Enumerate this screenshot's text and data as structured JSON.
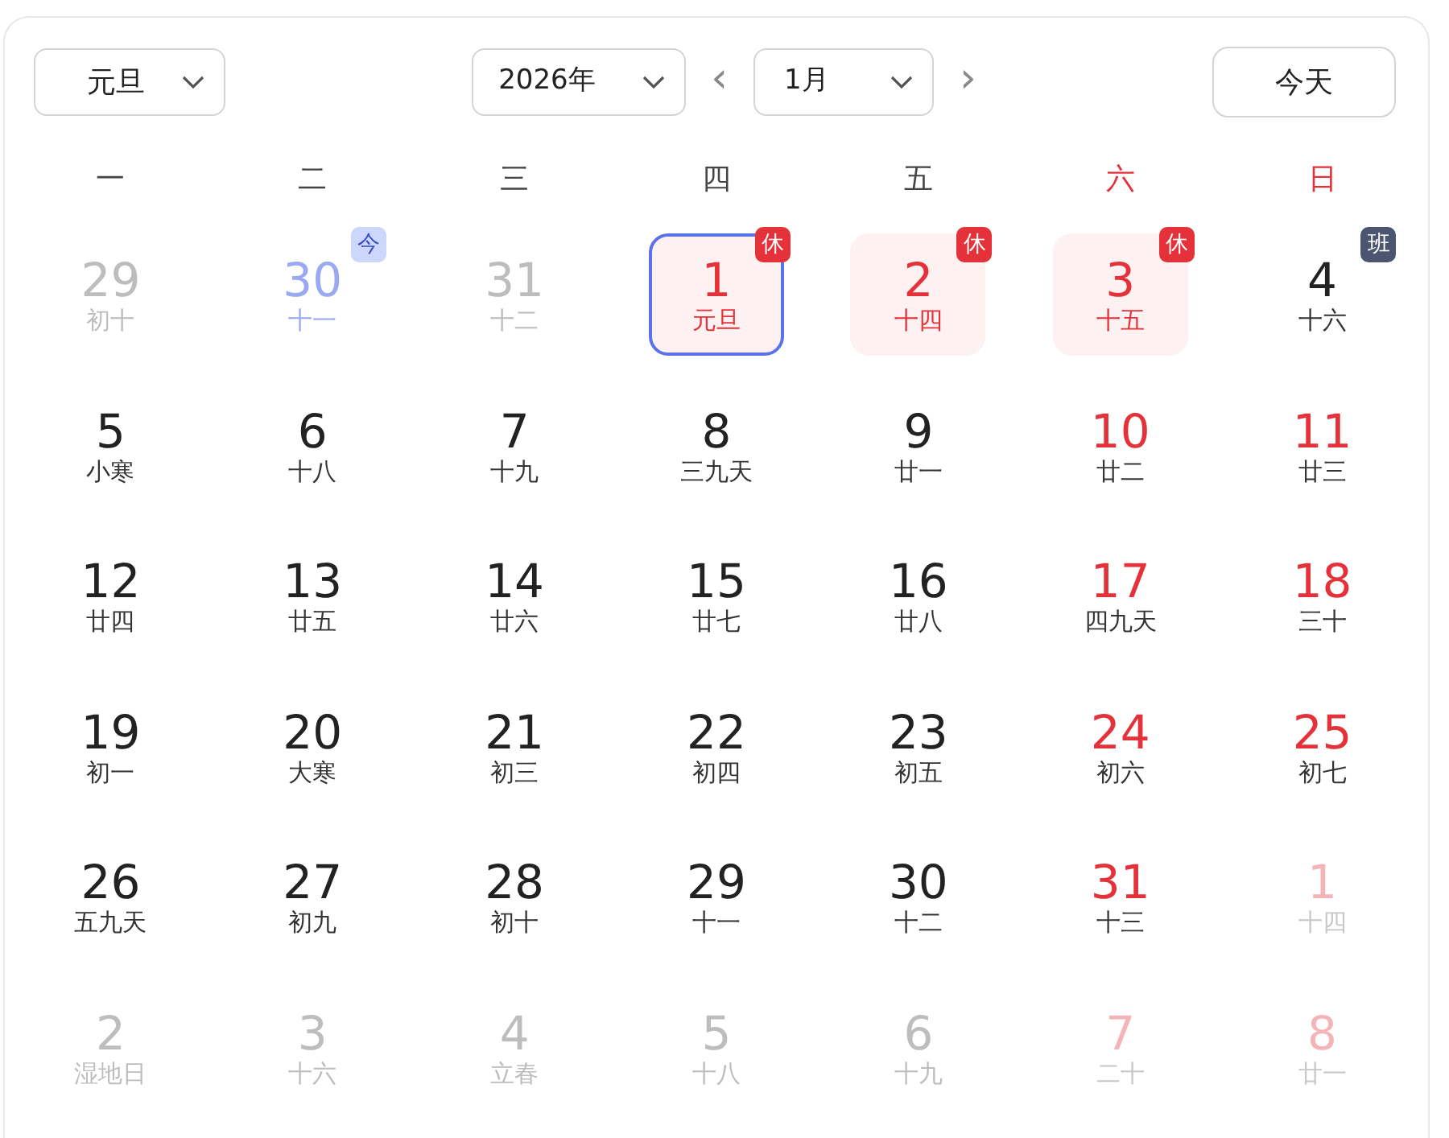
{
  "holiday_select": {
    "value": "元旦"
  },
  "year_select": {
    "value": "2026年"
  },
  "prev": "‹",
  "next": "›",
  "month_select": {
    "value": "1月"
  },
  "today_button": "今天",
  "weekdays": [
    {
      "label": "一",
      "weekend": false
    },
    {
      "label": "二",
      "weekend": false
    },
    {
      "label": "三",
      "weekend": false
    },
    {
      "label": "四",
      "weekend": false
    },
    {
      "label": "五",
      "weekend": false
    },
    {
      "label": "六",
      "weekend": true
    },
    {
      "label": "日",
      "weekend": true
    }
  ],
  "days": [
    {
      "day": "29",
      "lunar": "初十",
      "in_month": false,
      "weekend": false,
      "today": false,
      "selected": false,
      "holiday": false
    },
    {
      "day": "30",
      "lunar": "十一",
      "in_month": false,
      "weekend": false,
      "today": true,
      "selected": false,
      "holiday": false,
      "badge": {
        "kind": "today",
        "text": "今"
      }
    },
    {
      "day": "31",
      "lunar": "十二",
      "in_month": false,
      "weekend": false,
      "today": false,
      "selected": false,
      "holiday": false
    },
    {
      "day": "1",
      "lunar": "元旦",
      "in_month": true,
      "weekend": false,
      "today": false,
      "selected": true,
      "holiday": true,
      "badge": {
        "kind": "rest",
        "text": "休"
      }
    },
    {
      "day": "2",
      "lunar": "十四",
      "in_month": true,
      "weekend": false,
      "today": false,
      "selected": false,
      "holiday": true,
      "badge": {
        "kind": "rest",
        "text": "休"
      }
    },
    {
      "day": "3",
      "lunar": "十五",
      "in_month": true,
      "weekend": true,
      "today": false,
      "selected": false,
      "holiday": true,
      "badge": {
        "kind": "rest",
        "text": "休"
      }
    },
    {
      "day": "4",
      "lunar": "十六",
      "in_month": true,
      "weekend": false,
      "today": false,
      "selected": false,
      "holiday": false,
      "badge": {
        "kind": "work",
        "text": "班"
      }
    },
    {
      "day": "5",
      "lunar": "小寒",
      "in_month": true,
      "weekend": false,
      "today": false,
      "selected": false,
      "holiday": false
    },
    {
      "day": "6",
      "lunar": "十八",
      "in_month": true,
      "weekend": false,
      "today": false,
      "selected": false,
      "holiday": false
    },
    {
      "day": "7",
      "lunar": "十九",
      "in_month": true,
      "weekend": false,
      "today": false,
      "selected": false,
      "holiday": false
    },
    {
      "day": "8",
      "lunar": "三九天",
      "in_month": true,
      "weekend": false,
      "today": false,
      "selected": false,
      "holiday": false
    },
    {
      "day": "9",
      "lunar": "廿一",
      "in_month": true,
      "weekend": false,
      "today": false,
      "selected": false,
      "holiday": false
    },
    {
      "day": "10",
      "lunar": "廿二",
      "in_month": true,
      "weekend": true,
      "today": false,
      "selected": false,
      "holiday": false
    },
    {
      "day": "11",
      "lunar": "廿三",
      "in_month": true,
      "weekend": true,
      "today": false,
      "selected": false,
      "holiday": false
    },
    {
      "day": "12",
      "lunar": "廿四",
      "in_month": true,
      "weekend": false,
      "today": false,
      "selected": false,
      "holiday": false
    },
    {
      "day": "13",
      "lunar": "廿五",
      "in_month": true,
      "weekend": false,
      "today": false,
      "selected": false,
      "holiday": false
    },
    {
      "day": "14",
      "lunar": "廿六",
      "in_month": true,
      "weekend": false,
      "today": false,
      "selected": false,
      "holiday": false
    },
    {
      "day": "15",
      "lunar": "廿七",
      "in_month": true,
      "weekend": false,
      "today": false,
      "selected": false,
      "holiday": false
    },
    {
      "day": "16",
      "lunar": "廿八",
      "in_month": true,
      "weekend": false,
      "today": false,
      "selected": false,
      "holiday": false
    },
    {
      "day": "17",
      "lunar": "四九天",
      "in_month": true,
      "weekend": true,
      "today": false,
      "selected": false,
      "holiday": false
    },
    {
      "day": "18",
      "lunar": "三十",
      "in_month": true,
      "weekend": true,
      "today": false,
      "selected": false,
      "holiday": false
    },
    {
      "day": "19",
      "lunar": "初一",
      "in_month": true,
      "weekend": false,
      "today": false,
      "selected": false,
      "holiday": false
    },
    {
      "day": "20",
      "lunar": "大寒",
      "in_month": true,
      "weekend": false,
      "today": false,
      "selected": false,
      "holiday": false
    },
    {
      "day": "21",
      "lunar": "初三",
      "in_month": true,
      "weekend": false,
      "today": false,
      "selected": false,
      "holiday": false
    },
    {
      "day": "22",
      "lunar": "初四",
      "in_month": true,
      "weekend": false,
      "today": false,
      "selected": false,
      "holiday": false
    },
    {
      "day": "23",
      "lunar": "初五",
      "in_month": true,
      "weekend": false,
      "today": false,
      "selected": false,
      "holiday": false
    },
    {
      "day": "24",
      "lunar": "初六",
      "in_month": true,
      "weekend": true,
      "today": false,
      "selected": false,
      "holiday": false
    },
    {
      "day": "25",
      "lunar": "初七",
      "in_month": true,
      "weekend": true,
      "today": false,
      "selected": false,
      "holiday": false
    },
    {
      "day": "26",
      "lunar": "五九天",
      "in_month": true,
      "weekend": false,
      "today": false,
      "selected": false,
      "holiday": false
    },
    {
      "day": "27",
      "lunar": "初九",
      "in_month": true,
      "weekend": false,
      "today": false,
      "selected": false,
      "holiday": false
    },
    {
      "day": "28",
      "lunar": "初十",
      "in_month": true,
      "weekend": false,
      "today": false,
      "selected": false,
      "holiday": false
    },
    {
      "day": "29",
      "lunar": "十一",
      "in_month": true,
      "weekend": false,
      "today": false,
      "selected": false,
      "holiday": false
    },
    {
      "day": "30",
      "lunar": "十二",
      "in_month": true,
      "weekend": false,
      "today": false,
      "selected": false,
      "holiday": false
    },
    {
      "day": "31",
      "lunar": "十三",
      "in_month": true,
      "weekend": true,
      "today": false,
      "selected": false,
      "holiday": false
    },
    {
      "day": "1",
      "lunar": "十四",
      "in_month": false,
      "weekend": true,
      "today": false,
      "selected": false,
      "holiday": false
    },
    {
      "day": "2",
      "lunar": "湿地日",
      "in_month": false,
      "weekend": false,
      "today": false,
      "selected": false,
      "holiday": false
    },
    {
      "day": "3",
      "lunar": "十六",
      "in_month": false,
      "weekend": false,
      "today": false,
      "selected": false,
      "holiday": false
    },
    {
      "day": "4",
      "lunar": "立春",
      "in_month": false,
      "weekend": false,
      "today": false,
      "selected": false,
      "holiday": false
    },
    {
      "day": "5",
      "lunar": "十八",
      "in_month": false,
      "weekend": false,
      "today": false,
      "selected": false,
      "holiday": false
    },
    {
      "day": "6",
      "lunar": "十九",
      "in_month": false,
      "weekend": false,
      "today": false,
      "selected": false,
      "holiday": false
    },
    {
      "day": "7",
      "lunar": "二十",
      "in_month": false,
      "weekend": true,
      "today": false,
      "selected": false,
      "holiday": false
    },
    {
      "day": "8",
      "lunar": "廿一",
      "in_month": false,
      "weekend": true,
      "today": false,
      "selected": false,
      "holiday": false
    }
  ]
}
